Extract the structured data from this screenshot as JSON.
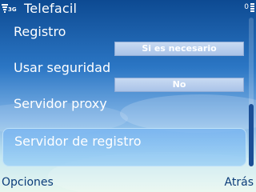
{
  "status_bar": {
    "network_type": "3G",
    "battery_level": "0",
    "signal_icon": "signal-strength-icon",
    "battery_icon": "battery-icon"
  },
  "window": {
    "title": "Telefacil"
  },
  "settings": [
    {
      "label": "Registro",
      "value": "Si es necesario"
    },
    {
      "label": "Usar seguridad",
      "value": "No"
    },
    {
      "label": "Servidor proxy"
    },
    {
      "label": "Servidor de registro",
      "selected": true
    }
  ],
  "softkeys": {
    "left": "Opciones",
    "right": "Atrás"
  },
  "colors": {
    "text": "#ffffff",
    "softkey_text": "#0c3d7a",
    "highlight": "#84bdf0",
    "scroll_thumb": "#1c4f96"
  }
}
